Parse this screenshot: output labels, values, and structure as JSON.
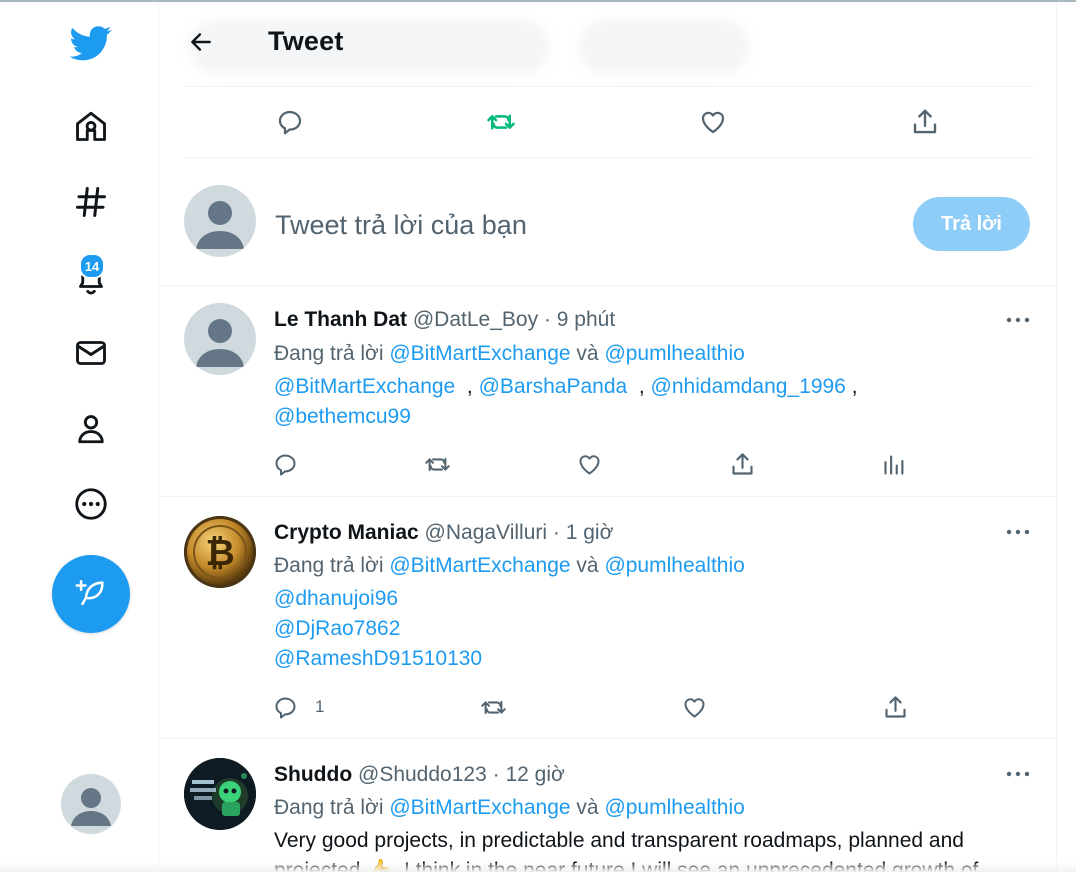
{
  "header": {
    "title": "Tweet",
    "back_icon": "arrow-left-icon"
  },
  "colors": {
    "accent": "#1d9bf0",
    "retweet_active": "#00ba7c",
    "reply_button_disabled": "#8ecdf8",
    "muted_text": "#536471"
  },
  "sidebar": {
    "items": [
      {
        "icon": "twitter-logo-icon"
      },
      {
        "icon": "home-icon"
      },
      {
        "icon": "hashtag-icon"
      },
      {
        "icon": "bell-icon",
        "badge": "14"
      },
      {
        "icon": "mail-icon"
      },
      {
        "icon": "profile-icon"
      },
      {
        "icon": "more-circle-icon"
      }
    ],
    "compose_icon": "feather-plus-icon"
  },
  "main_tweet_actions": [
    "reply-icon",
    "retweet-icon",
    "like-icon",
    "share-icon"
  ],
  "composer": {
    "placeholder": "Tweet trả lời của bạn",
    "button_label": "Trả lời"
  },
  "tweets": [
    {
      "name": "Le Thanh Dat",
      "handle": "@DatLe_Boy",
      "time": "9 phút",
      "dot": "·",
      "replying_prefix": "Đang trả lời",
      "replying_to_1": "@BitMartExchange",
      "replying_and": "và",
      "replying_to_2": "@pumlhealthio",
      "mentions": [
        "@BitMartExchange",
        "@BarshaPanda",
        "@nhidamdang_1996",
        "@bethemcu99"
      ],
      "separator": ",",
      "reply_count": ""
    },
    {
      "name": "Crypto Maniac",
      "handle": "@NagaVilluri",
      "time": "1 giờ",
      "dot": "·",
      "replying_prefix": "Đang trả lời",
      "replying_to_1": "@BitMartExchange",
      "replying_and": "và",
      "replying_to_2": "@pumlhealthio",
      "mentions": [
        "@dhanujoi96",
        "@DjRao7862",
        "@RameshD91510130"
      ],
      "reply_count": "1"
    },
    {
      "name": "Shuddo",
      "handle": "@Shuddo123",
      "time": "12 giờ",
      "dot": "·",
      "replying_prefix": "Đang trả lời",
      "replying_to_1": "@BitMartExchange",
      "replying_and": "và",
      "replying_to_2": "@pumlhealthio",
      "text_line_1": "Very good projects, in predictable and transparent roadmaps, planned and",
      "text_line_2": "projected 👍. I think in the near future I will see an unprecedented growth of"
    }
  ]
}
